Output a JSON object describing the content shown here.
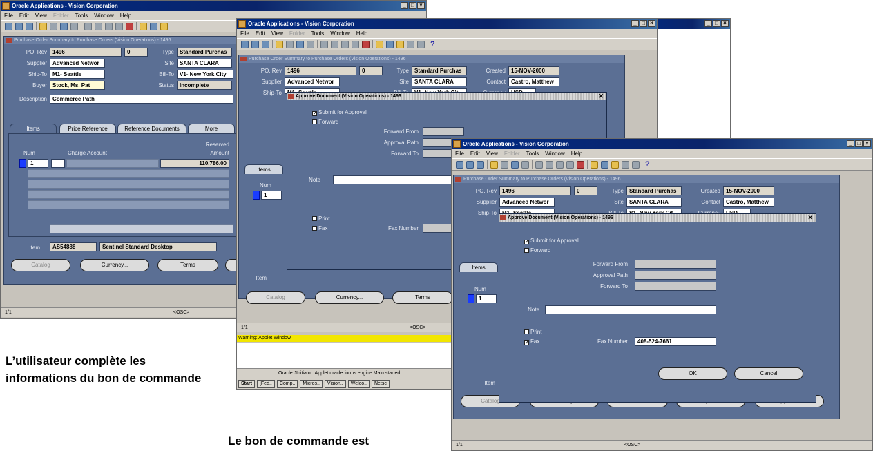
{
  "app_title": "Oracle Applications - Vision Corporation",
  "menu": [
    "File",
    "Edit",
    "View",
    "Folder",
    "Tools",
    "Window",
    "Help"
  ],
  "form_title": "Purchase Order Summary to Purchase Orders (Vision Operations) - 1496",
  "form_title_short": "Purchase Order Summary to Purchase Orders (Vision Operations) - 1496",
  "po": {
    "labels": {
      "po_rev": "PO, Rev",
      "type": "Type",
      "supplier": "Supplier",
      "site": "Site",
      "ship_to": "Ship-To",
      "bill_to": "Bill-To",
      "buyer": "Buyer",
      "status": "Status",
      "description": "Description",
      "created": "Created",
      "contact": "Contact",
      "currency": "Currency"
    },
    "po_number": "1496",
    "revision": "0",
    "type": "Standard Purchas",
    "supplier": "Advanced Networ",
    "site": "SANTA CLARA",
    "ship_to": "M1- Seattle",
    "bill_to": "V1- New York City",
    "bill_to_short": "V1- New York Cit",
    "buyer": "Stock, Ms. Pat",
    "status": "Incomplete",
    "description": "Commerce Path",
    "created": "15-NOV-2000",
    "contact": "Castro, Matthew",
    "currency": "USD"
  },
  "tabs": [
    "Items",
    "Price Reference",
    "Reference Documents",
    "More"
  ],
  "lines": {
    "num_header": "Num",
    "charge_account_header": "Charge Account",
    "reserved_header": "Reserved",
    "amount_header": "Amount",
    "num": "1",
    "amount": "110,786.00"
  },
  "item": {
    "label": "Item",
    "code": "AS54888",
    "desc": "Sentinel Standard Desktop"
  },
  "buttons": {
    "catalog": "Catalog",
    "currency": "Currency...",
    "terms": "Terms",
    "shipments": "Shipments",
    "approve": "Approve..."
  },
  "status_bar": {
    "record": "1/1",
    "osc": "<OSC>"
  },
  "dialog": {
    "title": "Approve Document (Vision Operations) - 1496",
    "submit": "Submit for Approval",
    "forward": "Forward",
    "forward_from": "Forward From",
    "approval_path": "Approval Path",
    "forward_to": "Forward To",
    "note": "Note",
    "print": "Print",
    "fax": "Fax",
    "fax_number_label": "Fax Number",
    "fax_number": "408-524-7661",
    "ok": "OK",
    "cancel": "Cancel"
  },
  "applet_warning": "Warning: Applet Window",
  "initiator_status": "Oracle JInitiator: Applet oracle.forms.engine.Main started",
  "taskbar": [
    "Start",
    "[Fed..",
    "Comp..",
    "Micros..",
    "Vision..",
    "Welco..",
    "Netsc"
  ],
  "captions": {
    "left": "L’utilisateur complète les informations du bon de commande",
    "bottom": "Le bon de commande est"
  }
}
